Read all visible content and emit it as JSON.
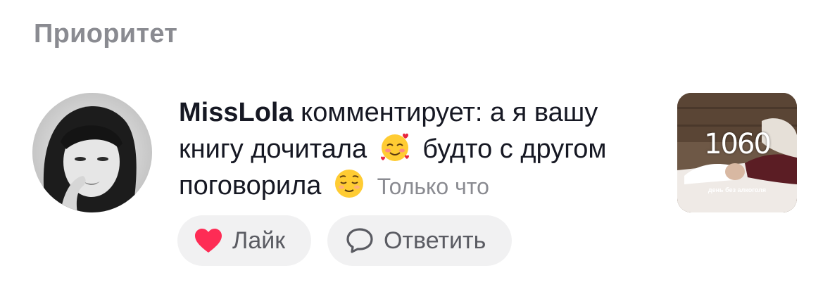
{
  "section": {
    "title": "Приоритет"
  },
  "notification": {
    "username": "MissLola",
    "text_line_1": " комментирует: а я вашу книгу дочитала",
    "text_line_2": " будто с другом поговорила",
    "timestamp": "Только что",
    "emoji_1": "smiling-face-with-hearts",
    "emoji_2": "relieved-face",
    "thumbnail": {
      "counter": "1060",
      "caption": "день без алкоголя"
    }
  },
  "actions": {
    "like_label": "Лайк",
    "reply_label": "Ответить"
  },
  "colors": {
    "like_heart": "#fe2c55",
    "secondary_text": "#8a8b91",
    "button_bg": "#f1f1f2"
  }
}
